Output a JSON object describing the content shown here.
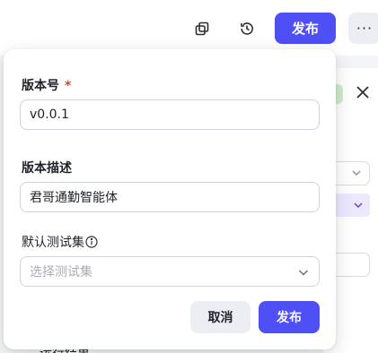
{
  "toolbar": {
    "publish_label": "发布",
    "more_label": "···",
    "icons": [
      "copy-icon",
      "history-icon"
    ]
  },
  "background": {
    "bottom_text": "运行结果"
  },
  "dialog": {
    "version_label": "版本号",
    "required_mark": "*",
    "version_value": "v0.0.1",
    "description_label": "版本描述",
    "description_value": "君哥通勤智能体",
    "testset_label": "默认测试集",
    "testset_placeholder": "选择测试集",
    "cancel_label": "取消",
    "publish_label": "发布"
  },
  "colors": {
    "accent": "#4e4ff5",
    "required": "#e0451f",
    "secondary_button": "#eceef3"
  }
}
